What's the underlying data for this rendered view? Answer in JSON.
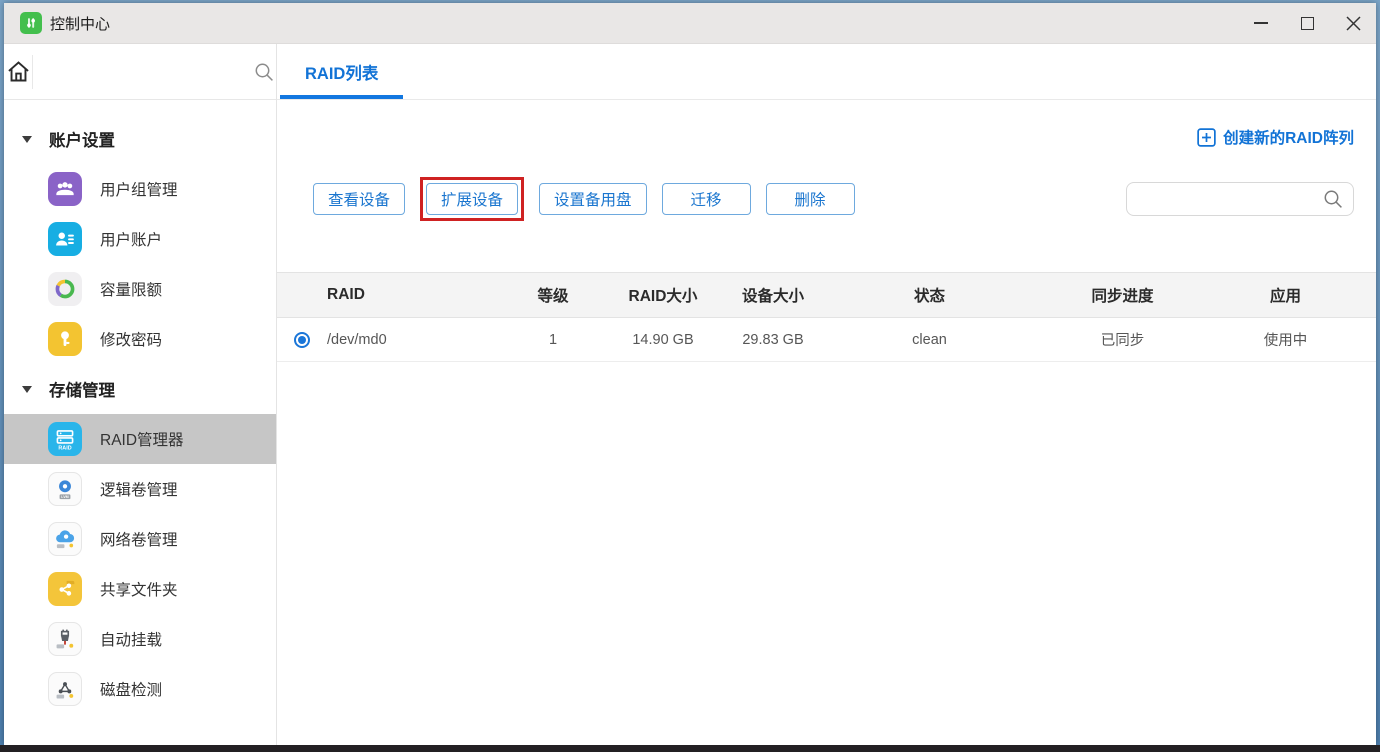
{
  "window": {
    "title": "控制中心"
  },
  "sidebar": {
    "sections": [
      {
        "label": "账户设置",
        "items": [
          {
            "label": "用户组管理",
            "icon": "users-group-icon"
          },
          {
            "label": "用户账户",
            "icon": "user-account-icon"
          },
          {
            "label": "容量限额",
            "icon": "quota-donut-icon"
          },
          {
            "label": "修改密码",
            "icon": "password-key-icon"
          }
        ]
      },
      {
        "label": "存储管理",
        "items": [
          {
            "label": "RAID管理器",
            "icon": "raid-manager-icon",
            "selected": true
          },
          {
            "label": "逻辑卷管理",
            "icon": "lvm-disk-icon"
          },
          {
            "label": "网络卷管理",
            "icon": "network-volume-cloud-icon"
          },
          {
            "label": "共享文件夹",
            "icon": "shared-folder-icon"
          },
          {
            "label": "自动挂载",
            "icon": "automount-plug-icon"
          },
          {
            "label": "磁盘检测",
            "icon": "disk-check-icon"
          }
        ]
      }
    ],
    "search": {
      "value": "",
      "placeholder": ""
    }
  },
  "tab": {
    "label": "RAID列表"
  },
  "actions": {
    "create": "创建新的RAID阵列"
  },
  "toolbar": {
    "buttons": [
      "查看设备",
      "扩展设备",
      "设置备用盘",
      "迁移",
      "删除"
    ],
    "highlighted_button": "扩展设备"
  },
  "search": {
    "value": "",
    "placeholder": ""
  },
  "table": {
    "columns": [
      "RAID",
      "等级",
      "RAID大小",
      "设备大小",
      "状态",
      "同步进度",
      "应用"
    ],
    "rows": [
      {
        "selected": true,
        "cells": [
          "/dev/md0",
          "1",
          "14.90 GB",
          "29.83 GB",
          "clean",
          "已同步",
          "使用中"
        ]
      }
    ]
  },
  "colors": {
    "accent_blue": "#1273d6",
    "highlight_red": "#cf2222",
    "selected_item_bg": "#c6c6c6",
    "app_icon_green": "#43bf4d",
    "titlebar_bg": "#e9e7e6",
    "table_header_bg": "#f4f4f4"
  }
}
